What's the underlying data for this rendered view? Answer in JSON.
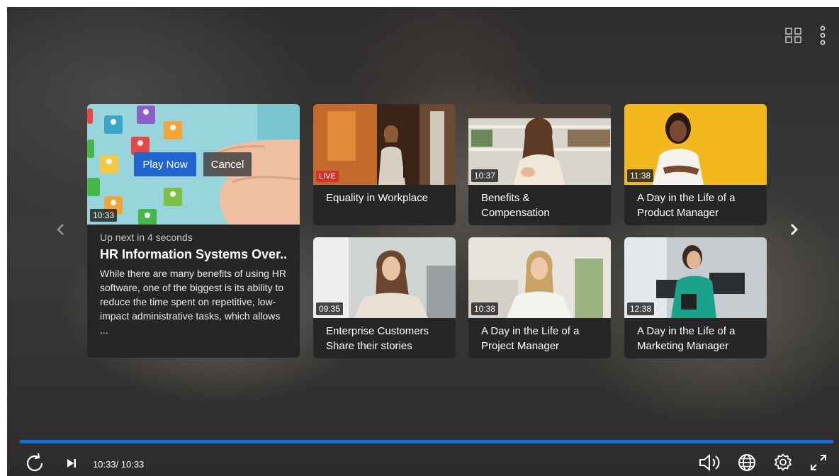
{
  "feature": {
    "duration": "10:33",
    "play_label": "Play Now",
    "cancel_label": "Cancel",
    "upnext": "Up next in 4 seconds",
    "title": "HR Information Systems Over...",
    "description": "While there are many benefits of using HR software, one of the biggest is its ability to reduce the time spent on repetitive, low-impact administrative tasks, which allows ..."
  },
  "cards": [
    {
      "badge": "LIVE",
      "title": "Equality in Workplace"
    },
    {
      "badge": "10:37",
      "title": "Benefits & Compensation"
    },
    {
      "badge": "11:38",
      "title": "A Day in the Life of a Product Manager"
    },
    {
      "badge": "09:35",
      "title": "Enterprise Customers Share their stories"
    },
    {
      "badge": "10:38",
      "title": "A Day in the Life of a Project Manager"
    },
    {
      "badge": "12:38",
      "title": "A Day in the Life of a Marketing Manager"
    }
  ],
  "player": {
    "time_readout": "10:33/ 10:33",
    "progress": 1.0,
    "accent": "#1a6dd8"
  },
  "icons": {
    "top": [
      "grid-icon",
      "more-vertical-icon"
    ],
    "nav": [
      "chevron-left-icon",
      "chevron-right-icon"
    ],
    "controls": [
      "replay-icon",
      "skip-next-icon",
      "volume-icon",
      "globe-icon",
      "settings-icon",
      "fullscreen-icon"
    ]
  }
}
